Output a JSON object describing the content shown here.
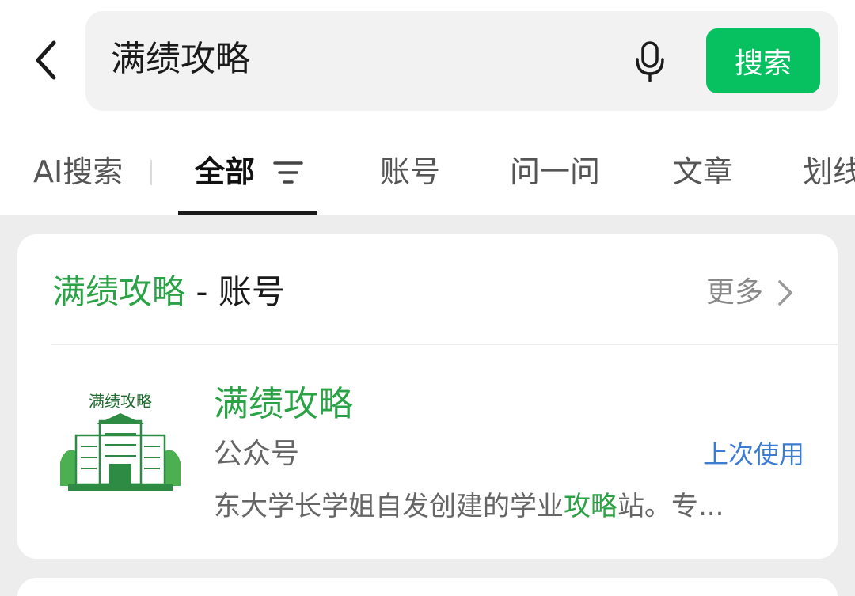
{
  "search": {
    "query": "满绩攻略",
    "button_label": "搜索"
  },
  "tabs": [
    {
      "label": "AI搜索"
    },
    {
      "label": "全部"
    },
    {
      "label": "账号"
    },
    {
      "label": "问一问"
    },
    {
      "label": "文章"
    },
    {
      "label": "划线"
    }
  ],
  "section": {
    "title_highlight": "满绩攻略",
    "title_suffix": " - 账号",
    "more_label": "更多"
  },
  "account": {
    "avatar_text": "满绩攻略",
    "name": "满绩攻略",
    "type": "公众号",
    "last_used": "上次使用",
    "desc_before": "东大学长学姐自发创建的学业",
    "desc_highlight": "攻略",
    "desc_after": "站。专..."
  },
  "colors": {
    "accent": "#07c160",
    "highlight": "#2ba245",
    "link": "#3b7bd0"
  },
  "icons": {
    "back": "chevron-left-icon",
    "mic": "microphone-icon",
    "filter": "filter-icon",
    "more": "chevron-right-icon"
  }
}
